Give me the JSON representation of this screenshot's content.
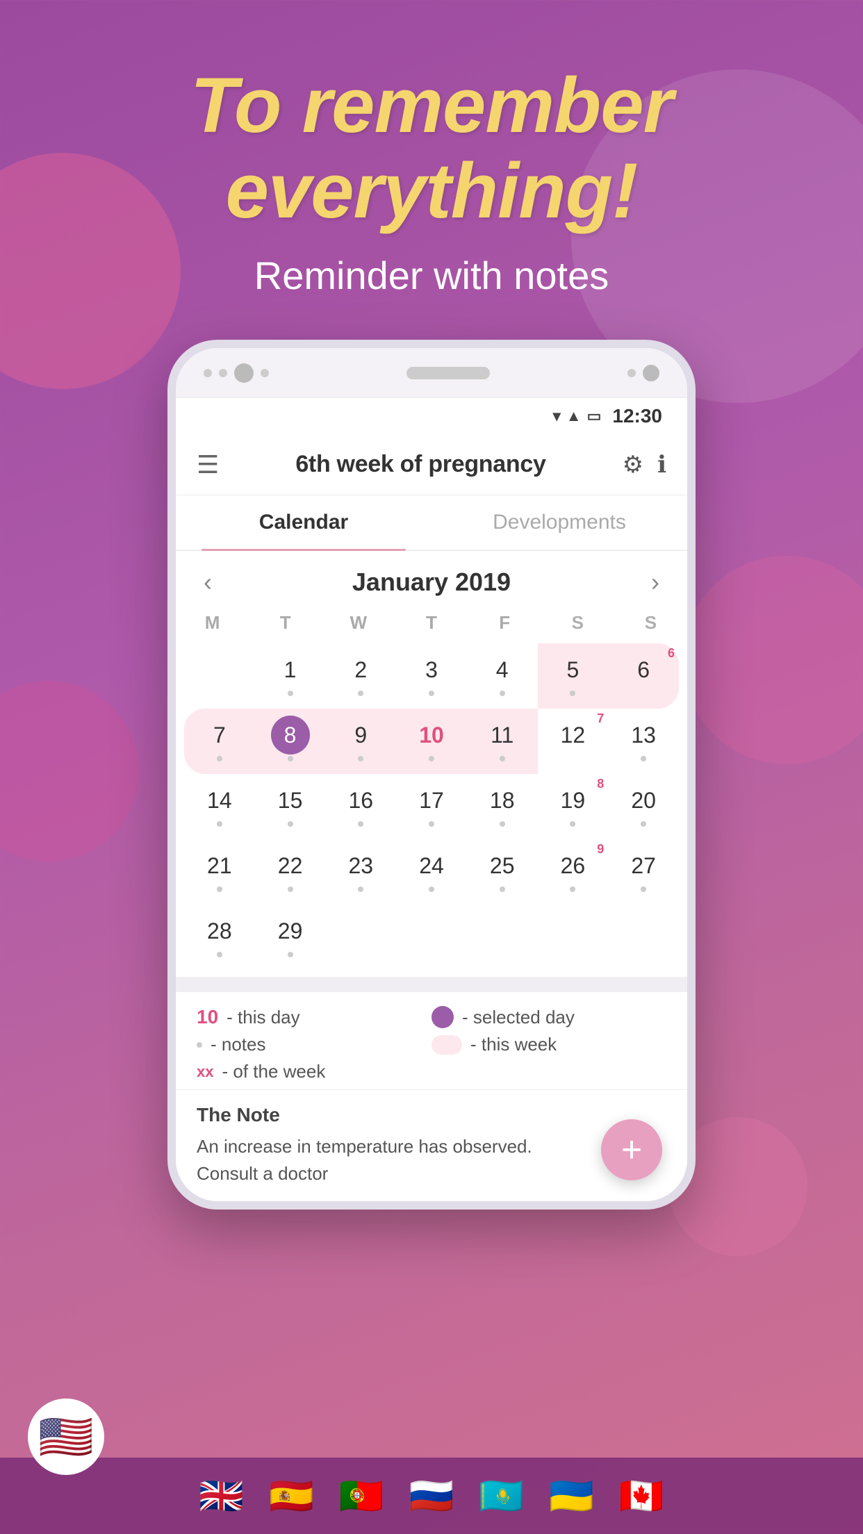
{
  "hero": {
    "title_line1": "To remember",
    "title_line2": "everything!",
    "subtitle": "Reminder with notes"
  },
  "status_bar": {
    "time": "12:30"
  },
  "app_header": {
    "title": "6th week of pregnancy"
  },
  "tabs": [
    {
      "label": "Calendar",
      "active": true
    },
    {
      "label": "Developments",
      "active": false
    }
  ],
  "calendar": {
    "month_title": "January 2019",
    "days_of_week": [
      "M",
      "T",
      "W",
      "T",
      "F",
      "S",
      "S"
    ],
    "weeks": [
      [
        {
          "day": "",
          "week_num": "",
          "dot": false,
          "in_week": false,
          "selected": false,
          "today": false,
          "empty": true
        },
        {
          "day": "1",
          "week_num": "",
          "dot": true,
          "in_week": false,
          "selected": false,
          "today": false
        },
        {
          "day": "2",
          "week_num": "",
          "dot": true,
          "in_week": false,
          "selected": false,
          "today": false
        },
        {
          "day": "3",
          "week_num": "",
          "dot": true,
          "in_week": false,
          "selected": false,
          "today": false
        },
        {
          "day": "4",
          "week_num": "",
          "dot": true,
          "in_week": false,
          "selected": false,
          "today": false
        },
        {
          "day": "5",
          "week_num": "",
          "dot": true,
          "in_week": true,
          "selected": false,
          "today": false
        },
        {
          "day": "6",
          "week_num": "6",
          "dot": false,
          "in_week": true,
          "selected": false,
          "today": false
        }
      ],
      [
        {
          "day": "7",
          "week_num": "",
          "dot": true,
          "in_week": true,
          "selected": false,
          "today": false
        },
        {
          "day": "8",
          "week_num": "",
          "dot": true,
          "in_week": true,
          "selected": true,
          "today": false
        },
        {
          "day": "9",
          "week_num": "",
          "dot": true,
          "in_week": true,
          "selected": false,
          "today": false
        },
        {
          "day": "10",
          "week_num": "",
          "dot": true,
          "in_week": true,
          "selected": false,
          "today": true
        },
        {
          "day": "11",
          "week_num": "",
          "dot": true,
          "in_week": true,
          "selected": false,
          "today": false
        },
        {
          "day": "12",
          "week_num": "7",
          "dot": false,
          "in_week": false,
          "selected": false,
          "today": false
        },
        {
          "day": "13",
          "week_num": "",
          "dot": true,
          "in_week": false,
          "selected": false,
          "today": false
        }
      ],
      [
        {
          "day": "14",
          "week_num": "",
          "dot": true,
          "in_week": false,
          "selected": false,
          "today": false
        },
        {
          "day": "15",
          "week_num": "",
          "dot": true,
          "in_week": false,
          "selected": false,
          "today": false
        },
        {
          "day": "16",
          "week_num": "",
          "dot": true,
          "in_week": false,
          "selected": false,
          "today": false
        },
        {
          "day": "17",
          "week_num": "",
          "dot": true,
          "in_week": false,
          "selected": false,
          "today": false
        },
        {
          "day": "18",
          "week_num": "",
          "dot": true,
          "in_week": false,
          "selected": false,
          "today": false
        },
        {
          "day": "19",
          "week_num": "8",
          "dot": true,
          "in_week": false,
          "selected": false,
          "today": false
        },
        {
          "day": "20",
          "week_num": "",
          "dot": true,
          "in_week": false,
          "selected": false,
          "today": false
        }
      ],
      [
        {
          "day": "21",
          "week_num": "",
          "dot": true,
          "in_week": false,
          "selected": false,
          "today": false
        },
        {
          "day": "22",
          "week_num": "",
          "dot": true,
          "in_week": false,
          "selected": false,
          "today": false
        },
        {
          "day": "23",
          "week_num": "",
          "dot": true,
          "in_week": false,
          "selected": false,
          "today": false
        },
        {
          "day": "24",
          "week_num": "",
          "dot": true,
          "in_week": false,
          "selected": false,
          "today": false
        },
        {
          "day": "25",
          "week_num": "",
          "dot": true,
          "in_week": false,
          "selected": false,
          "today": false
        },
        {
          "day": "26",
          "week_num": "9",
          "dot": true,
          "in_week": false,
          "selected": false,
          "today": false
        },
        {
          "day": "27",
          "week_num": "",
          "dot": true,
          "in_week": false,
          "selected": false,
          "today": false
        }
      ],
      [
        {
          "day": "28",
          "week_num": "",
          "dot": true,
          "in_week": false,
          "selected": false,
          "today": false
        },
        {
          "day": "29",
          "week_num": "",
          "dot": true,
          "in_week": false,
          "selected": false,
          "today": false
        },
        {
          "day": "",
          "week_num": "",
          "dot": false,
          "in_week": false,
          "selected": false,
          "today": false,
          "empty": true
        },
        {
          "day": "",
          "week_num": "",
          "dot": false,
          "in_week": false,
          "selected": false,
          "today": false,
          "empty": true
        },
        {
          "day": "",
          "week_num": "",
          "dot": false,
          "in_week": false,
          "selected": false,
          "today": false,
          "empty": true
        },
        {
          "day": "",
          "week_num": "",
          "dot": false,
          "in_week": false,
          "selected": false,
          "today": false,
          "empty": true
        },
        {
          "day": "",
          "week_num": "",
          "dot": false,
          "in_week": false,
          "selected": false,
          "today": false,
          "empty": true
        }
      ]
    ]
  },
  "legend": {
    "today_num": "10",
    "today_label": "- this day",
    "dot_label": "- notes",
    "week_label": "- of the week",
    "selected_label": "- selected day",
    "this_week_label": "- this week"
  },
  "note": {
    "title": "The Note",
    "text": "An increase in temperature has observed.\nConsult a doctor"
  },
  "fab": {
    "label": "+"
  },
  "flags": [
    "🇬🇧",
    "🇪🇸",
    "🇵🇹",
    "🇷🇺",
    "🇰🇿",
    "🇺🇦",
    "🇨🇦"
  ],
  "us_flag": "🇺🇸",
  "colors": {
    "accent_purple": "#9b5ca8",
    "accent_pink": "#e05080",
    "week_highlight": "#fde8ee",
    "fab_pink": "#e8a0c0"
  }
}
